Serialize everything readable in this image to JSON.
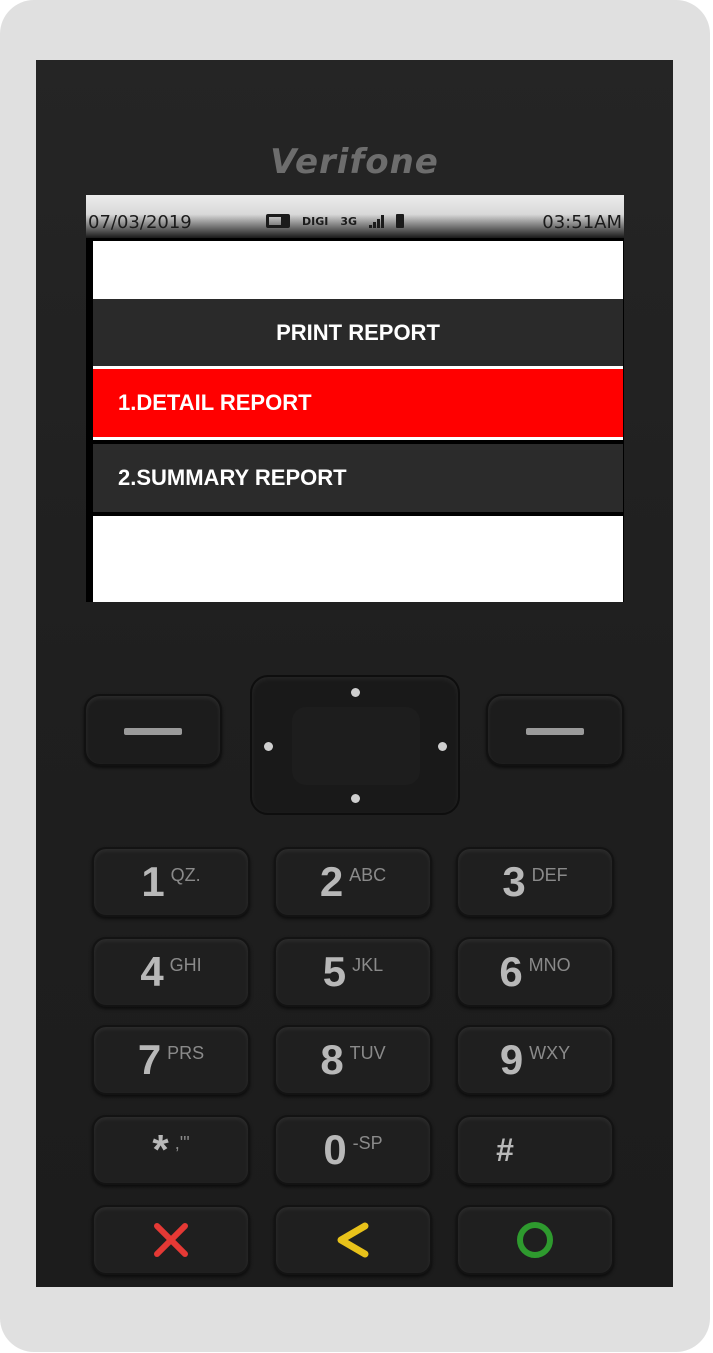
{
  "device": {
    "brand": "Verifone"
  },
  "status_bar": {
    "date": "07/03/2019",
    "carrier": "DIGI",
    "network": "3G",
    "time": "03:51AM"
  },
  "screen": {
    "title": "PRINT REPORT",
    "menu": [
      {
        "label": "1.DETAIL REPORT",
        "selected": true
      },
      {
        "label": "2.SUMMARY REPORT",
        "selected": false
      }
    ]
  },
  "keypad": {
    "keys": [
      {
        "main": "1",
        "sub": "QZ."
      },
      {
        "main": "2",
        "sub": "ABC"
      },
      {
        "main": "3",
        "sub": "DEF"
      },
      {
        "main": "4",
        "sub": "GHI"
      },
      {
        "main": "5",
        "sub": "JKL"
      },
      {
        "main": "6",
        "sub": "MNO"
      },
      {
        "main": "7",
        "sub": "PRS"
      },
      {
        "main": "8",
        "sub": "TUV"
      },
      {
        "main": "9",
        "sub": "WXY"
      },
      {
        "main": "*",
        "sub": ",'\""
      },
      {
        "main": "0",
        "sub": "-SP"
      },
      {
        "main": "#",
        "sub": ""
      }
    ],
    "function_keys": [
      {
        "name": "cancel",
        "icon": "x-icon",
        "color": "#e53935"
      },
      {
        "name": "clear",
        "icon": "back-arrow-icon",
        "color": "#e8c21a"
      },
      {
        "name": "enter",
        "icon": "circle-icon",
        "color": "#2e9a2e"
      }
    ]
  },
  "colors": {
    "selected_item": "#ff0000",
    "device_body": "#222222",
    "frame": "#e0e0e0"
  }
}
